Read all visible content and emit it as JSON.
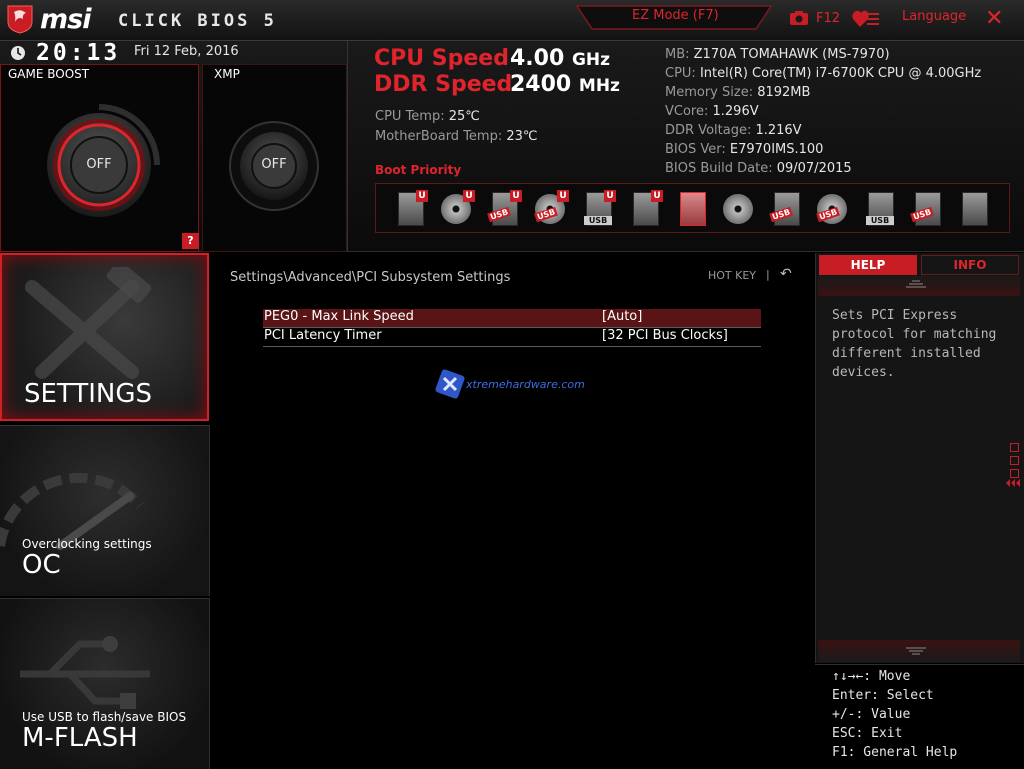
{
  "header": {
    "brand": "msi",
    "product_title": "CLICK BIOS 5",
    "ez_mode_label": "EZ Mode (F7)",
    "screenshot_label": "F12",
    "language_label": "Language",
    "close_glyph": "✕"
  },
  "status": {
    "time": "20:13",
    "date": "Fri  12 Feb, 2016",
    "game_boost_label": "GAME BOOST",
    "game_boost_state": "OFF",
    "xmp_label": "XMP",
    "xmp_state": "OFF",
    "help_glyph": "?"
  },
  "speeds": {
    "cpu_label": "CPU Speed",
    "cpu_value": "4.00",
    "cpu_unit": "GHz",
    "ddr_label": "DDR Speed",
    "ddr_value": "2400",
    "ddr_unit": "MHz",
    "cpu_temp_label": "CPU Temp: ",
    "cpu_temp_value": "25℃",
    "mb_temp_label": "MotherBoard Temp: ",
    "mb_temp_value": "23℃"
  },
  "boot_priority": {
    "label": "Boot Priority",
    "devices": [
      {
        "icon": "hdd-icon",
        "badge": "U"
      },
      {
        "icon": "optical-disc-icon",
        "badge": "U"
      },
      {
        "icon": "usb-hdd-icon",
        "badge": "U",
        "tag": "USB"
      },
      {
        "icon": "usb-disc-icon",
        "badge": "U",
        "tag": "USB"
      },
      {
        "icon": "usb-key-icon",
        "badge": "U",
        "plain_tag": "USB"
      },
      {
        "icon": "floppy-icon",
        "badge": "U"
      },
      {
        "icon": "hdd-icon-highlighted"
      },
      {
        "icon": "optical-disc-icon"
      },
      {
        "icon": "usb-hdd-icon",
        "tag": "USB"
      },
      {
        "icon": "usb-disc-icon",
        "tag": "USB"
      },
      {
        "icon": "usb-key-icon",
        "plain_tag": "USB"
      },
      {
        "icon": "usb-floppy-icon",
        "tag": "USB"
      },
      {
        "icon": "network-icon"
      }
    ]
  },
  "system_info": {
    "mb_label": "MB: ",
    "mb": "Z170A TOMAHAWK (MS-7970)",
    "cpu_label": "CPU: ",
    "cpu": "Intel(R) Core(TM) i7-6700K CPU @ 4.00GHz",
    "mem_label": "Memory Size: ",
    "mem": "8192MB",
    "vcore_label": "VCore: ",
    "vcore": "1.296V",
    "ddrv_label": "DDR Voltage: ",
    "ddrv": "1.216V",
    "biosver_label": "BIOS Ver: ",
    "biosver": "E7970IMS.100",
    "biosdate_label": "BIOS Build Date: ",
    "biosdate": "09/07/2015"
  },
  "menu": {
    "settings": {
      "title": "SETTINGS"
    },
    "oc": {
      "subtitle": "Overclocking settings",
      "title": "OC"
    },
    "mflash": {
      "subtitle": "Use USB to flash/save BIOS",
      "title": "M-FLASH"
    }
  },
  "main": {
    "breadcrumb": "Settings\\Advanced\\PCI Subsystem Settings",
    "hotkey_label": "HOT KEY",
    "hotkey_sep": "|",
    "back_glyph": "↶",
    "rows": [
      {
        "name": "PEG0 - Max Link Speed",
        "value": "[Auto]"
      },
      {
        "name": "PCI Latency Timer",
        "value": "[32 PCI Bus Clocks]"
      }
    ],
    "watermark": "xtremehardware.com"
  },
  "help": {
    "tab_help": "HELP",
    "tab_info": "INFO",
    "text": "Sets PCI Express protocol for matching different installed devices.",
    "keys": [
      "↑↓→←:  Move",
      "Enter:  Select",
      "+/-:  Value",
      "ESC:  Exit",
      "F1:  General Help"
    ]
  },
  "colors": {
    "accent": "#e0242c",
    "accent_dark": "#c81d24",
    "background": "#000000"
  }
}
